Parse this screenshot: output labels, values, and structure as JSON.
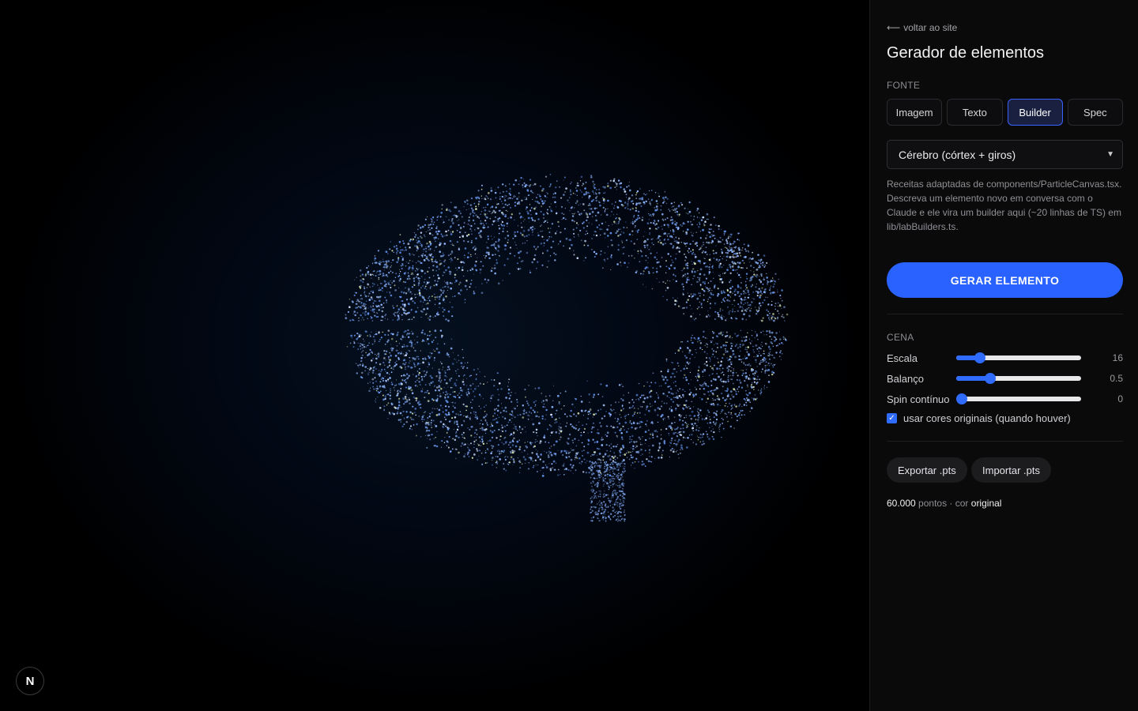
{
  "panel": {
    "back_label": "voltar ao site",
    "title": "Gerador de elementos",
    "source_label": "FONTE",
    "tabs": [
      {
        "label": "Imagem",
        "active": false
      },
      {
        "label": "Texto",
        "active": false
      },
      {
        "label": "Builder",
        "active": true
      },
      {
        "label": "Spec",
        "active": false
      }
    ],
    "builder_select": {
      "value": "Cérebro (córtex + giros)"
    },
    "description": "Receitas adaptadas de components/ParticleCanvas.tsx. Descreva um elemento novo em conversa com o Claude e ele vira um builder aqui (~20 linhas de TS) em lib/labBuilders.ts.",
    "generate_label": "GERAR ELEMENTO",
    "scene_label": "CENA",
    "sliders": [
      {
        "label": "Escala",
        "value": "16",
        "level": 0.19
      },
      {
        "label": "Balanço",
        "value": "0.5",
        "level": 0.27
      },
      {
        "label": "Spin contínuo",
        "value": "0",
        "level": 0.0
      }
    ],
    "use_original_colors": {
      "label": "usar cores originais (quando houver)",
      "checked": true
    },
    "export_label": "Exportar .pts",
    "import_label": "Importar .pts",
    "stats": {
      "count": "60.000",
      "points_word": "pontos · cor",
      "color_mode": "original"
    }
  },
  "badge": {
    "letter": "N"
  },
  "colors": {
    "accent": "#2962ff",
    "panel_bg": "#0a0a0a",
    "particle": "#8fb6ff"
  }
}
